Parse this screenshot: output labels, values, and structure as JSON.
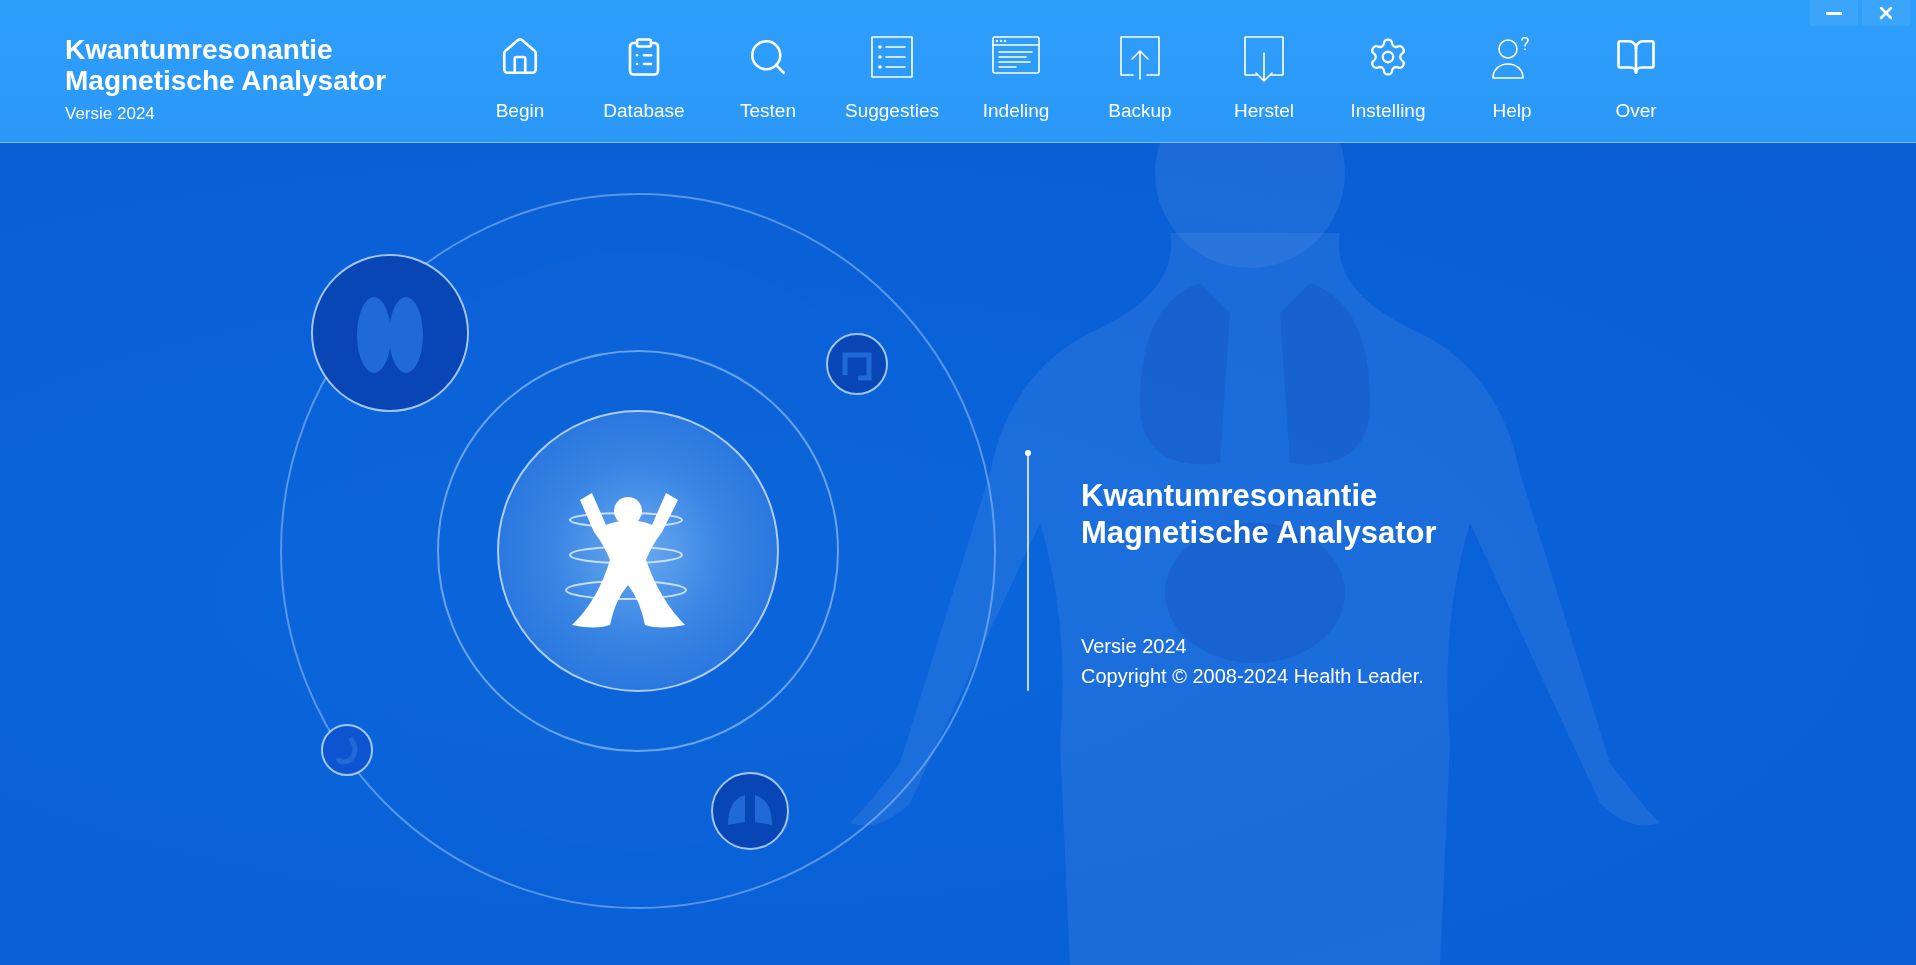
{
  "header": {
    "title_lines": [
      "Kwantumresonantie",
      "Magnetische Analysator"
    ],
    "version": "Versie 2024"
  },
  "toolbar": [
    {
      "label": "Begin",
      "kind": "home"
    },
    {
      "label": "Database",
      "kind": "clipboard"
    },
    {
      "label": "Testen",
      "kind": "magnifier"
    },
    {
      "label": "Suggesties",
      "kind": "starlist"
    },
    {
      "label": "Indeling",
      "kind": "window"
    },
    {
      "label": "Backup",
      "kind": "upload"
    },
    {
      "label": "Herstel",
      "kind": "download"
    },
    {
      "label": "Instelling",
      "kind": "gear"
    },
    {
      "label": "Help",
      "kind": "user-question"
    },
    {
      "label": "Over",
      "kind": "book"
    }
  ],
  "about": {
    "title_lines": [
      "Kwantumresonantie",
      "Magnetische Analysator"
    ],
    "version": "Versie 2024",
    "copyright": "Copyright © 2008-2024 Health Leader."
  }
}
